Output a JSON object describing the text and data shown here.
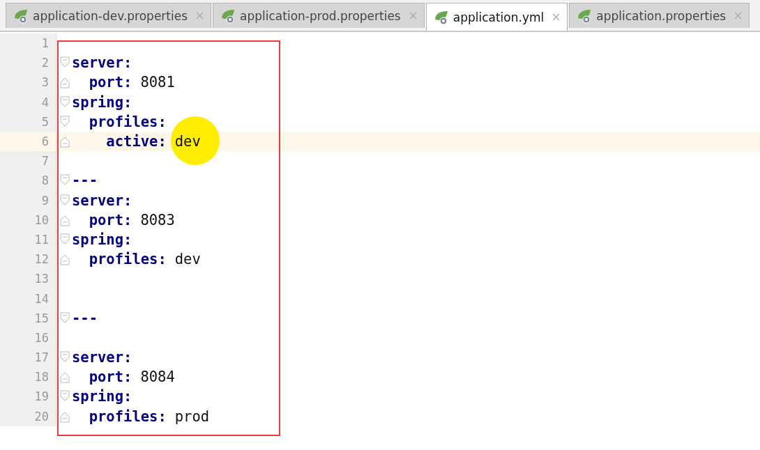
{
  "tabs": [
    {
      "label": "application-dev.properties",
      "selected": false
    },
    {
      "label": "application-prod.properties",
      "selected": false
    },
    {
      "label": "application.yml",
      "selected": true
    },
    {
      "label": "application.properties",
      "selected": false
    }
  ],
  "editor": {
    "lines": [
      {
        "number": "1",
        "kind": "plain",
        "current": false
      },
      {
        "number": "2",
        "key": "server:",
        "kind": "fold-start",
        "current": false
      },
      {
        "number": "3",
        "key": "  port:",
        "value": "8081",
        "kind": "fold-end",
        "current": false
      },
      {
        "number": "4",
        "key": "spring:",
        "kind": "fold-start",
        "current": false
      },
      {
        "number": "5",
        "key": "  profiles:",
        "kind": "fold-start",
        "current": false
      },
      {
        "number": "6",
        "key": "    active:",
        "value": "dev",
        "kind": "fold-end",
        "current": true
      },
      {
        "number": "7",
        "kind": "plain",
        "current": false
      },
      {
        "number": "8",
        "key": "---",
        "kind": "fold-start",
        "current": false
      },
      {
        "number": "9",
        "key": "server:",
        "kind": "fold-start",
        "current": false
      },
      {
        "number": "10",
        "key": "  port:",
        "value": "8083",
        "kind": "fold-end",
        "current": false
      },
      {
        "number": "11",
        "key": "spring:",
        "kind": "fold-start",
        "current": false
      },
      {
        "number": "12",
        "key": "  profiles:",
        "value": "dev",
        "kind": "fold-end",
        "current": false
      },
      {
        "number": "13",
        "kind": "plain",
        "current": false
      },
      {
        "number": "14",
        "kind": "plain",
        "current": false
      },
      {
        "number": "15",
        "key": "---",
        "kind": "fold-start",
        "current": false
      },
      {
        "number": "16",
        "kind": "plain",
        "current": false
      },
      {
        "number": "17",
        "key": "server:",
        "kind": "fold-start",
        "current": false
      },
      {
        "number": "18",
        "key": "  port:",
        "value": "8084",
        "kind": "fold-end",
        "current": false
      },
      {
        "number": "19",
        "key": "spring:",
        "kind": "fold-start",
        "current": false
      },
      {
        "number": "20",
        "key": "  profiles:",
        "value": "prod",
        "kind": "fold-end",
        "current": false
      }
    ]
  }
}
